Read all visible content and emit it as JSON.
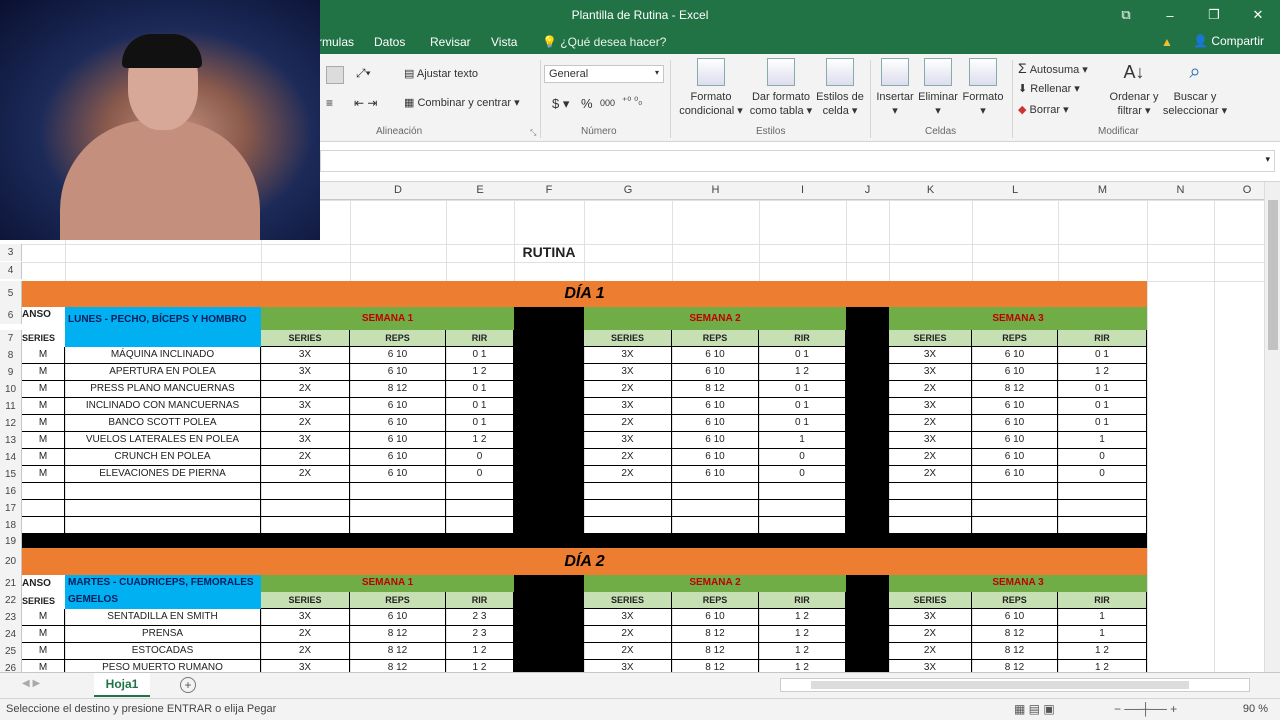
{
  "window": {
    "title": "Plantilla de Rutina - Excel",
    "controls": [
      "⧉",
      "–",
      "❐",
      "✕"
    ]
  },
  "menu": {
    "tabs": [
      "rmulas",
      "Datos",
      "Revisar",
      "Vista"
    ],
    "tell_me": "¿Qué desea hacer?",
    "share": "Compartir"
  },
  "ribbon": {
    "wrap_text": "Ajustar texto",
    "merge_center": "Combinar y centrar",
    "alignment_group": "Alineación",
    "number_format": "General",
    "number_group": "Número",
    "currency_symbol": "$",
    "percent_symbol": "%",
    "thousands_symbol": "000",
    "cond_format_1": "Formato",
    "cond_format_2": "condicional",
    "format_table_1": "Dar formato",
    "format_table_2": "como tabla",
    "cell_styles_1": "Estilos de",
    "cell_styles_2": "celda",
    "styles_group": "Estilos",
    "insert": "Insertar",
    "delete": "Eliminar",
    "format": "Formato",
    "cells_group": "Celdas",
    "autosum": "Autosuma",
    "fill": "Rellenar",
    "clear": "Borrar",
    "sort_1": "Ordenar y",
    "sort_2": "filtrar",
    "find_1": "Buscar y",
    "find_2": "seleccionar",
    "modify_group": "Modificar"
  },
  "columns": [
    "D",
    "E",
    "F",
    "G",
    "H",
    "I",
    "J",
    "K",
    "L",
    "M",
    "N",
    "O"
  ],
  "sheet": {
    "rutina_title": "RUTINA",
    "day1": "DÍA 1",
    "day2": "DÍA 2",
    "day1_name": "LUNES - PECHO, BÍCEPS Y HOMBRO",
    "day2_name": "MARTES - CUADRICEPS, FEMORALES",
    "day2_name_2": "GEMELOS",
    "week1": "SEMANA 1",
    "week2": "SEMANA 2",
    "week3": "SEMANA 3",
    "rest_fragment": "ANSO",
    "rest_series": "SERIES",
    "rest_m": "M",
    "series_hdr": "SERIES",
    "reps_hdr": "REPS",
    "rir_hdr": "RIR",
    "day1_rows": [
      {
        "n": "8",
        "ex": "MÁQUINA INCLINADO",
        "w1": [
          "3X",
          "6 10",
          "0 1"
        ],
        "w2": [
          "3X",
          "6 10",
          "0 1"
        ],
        "w3": [
          "3X",
          "6 10",
          "0 1"
        ]
      },
      {
        "n": "9",
        "ex": "APERTURA EN POLEA",
        "w1": [
          "3X",
          "6 10",
          "1 2"
        ],
        "w2": [
          "3X",
          "6 10",
          "1 2"
        ],
        "w3": [
          "3X",
          "6 10",
          "1 2"
        ]
      },
      {
        "n": "10",
        "ex": "PRESS PLANO MANCUERNAS",
        "w1": [
          "2X",
          "8 12",
          "0 1"
        ],
        "w2": [
          "2X",
          "8 12",
          "0 1"
        ],
        "w3": [
          "2X",
          "8 12",
          "0 1"
        ]
      },
      {
        "n": "11",
        "ex": "INCLINADO CON MANCUERNAS",
        "w1": [
          "3X",
          "6 10",
          "0 1"
        ],
        "w2": [
          "3X",
          "6 10",
          "0 1"
        ],
        "w3": [
          "3X",
          "6 10",
          "0 1"
        ]
      },
      {
        "n": "12",
        "ex": "BANCO SCOTT POLEA",
        "w1": [
          "2X",
          "6 10",
          "0 1"
        ],
        "w2": [
          "2X",
          "6 10",
          "0 1"
        ],
        "w3": [
          "2X",
          "6 10",
          "0 1"
        ]
      },
      {
        "n": "13",
        "ex": "VUELOS LATERALES EN POLEA",
        "w1": [
          "3X",
          "6 10",
          "1 2"
        ],
        "w2": [
          "3X",
          "6 10",
          "1"
        ],
        "w3": [
          "3X",
          "6 10",
          "1"
        ]
      },
      {
        "n": "14",
        "ex": "CRUNCH EN POLEA",
        "w1": [
          "2X",
          "6 10",
          "0"
        ],
        "w2": [
          "2X",
          "6 10",
          "0"
        ],
        "w3": [
          "2X",
          "6 10",
          "0"
        ]
      },
      {
        "n": "15",
        "ex": "ELEVACIONES DE PIERNA",
        "w1": [
          "2X",
          "6 10",
          "0"
        ],
        "w2": [
          "2X",
          "6 10",
          "0"
        ],
        "w3": [
          "2X",
          "6 10",
          "0"
        ]
      }
    ],
    "day2_rows": [
      {
        "n": "23",
        "ex": "SENTADILLA EN SMITH",
        "w1": [
          "3X",
          "6 10",
          "2 3"
        ],
        "w2": [
          "3X",
          "6 10",
          "1 2"
        ],
        "w3": [
          "3X",
          "6 10",
          "1"
        ]
      },
      {
        "n": "24",
        "ex": "PRENSA",
        "w1": [
          "2X",
          "8 12",
          "2 3"
        ],
        "w2": [
          "2X",
          "8 12",
          "1 2"
        ],
        "w3": [
          "2X",
          "8 12",
          "1"
        ]
      },
      {
        "n": "25",
        "ex": "ESTOCADAS",
        "w1": [
          "2X",
          "8 12",
          "1 2"
        ],
        "w2": [
          "2X",
          "8 12",
          "1 2"
        ],
        "w3": [
          "2X",
          "8 12",
          "1 2"
        ]
      },
      {
        "n": "26",
        "ex": "PESO MUERTO RUMANO",
        "w1": [
          "3X",
          "8 12",
          "1 2"
        ],
        "w2": [
          "3X",
          "8 12",
          "1 2"
        ],
        "w3": [
          "3X",
          "8 12",
          "1 2"
        ]
      }
    ]
  },
  "sheet_tab": "Hoja1",
  "add_sheet": "+",
  "status": {
    "message": "Seleccione el destino y presione ENTRAR o elija Pegar",
    "zoom": "90 %"
  },
  "colors": {
    "excel_green": "#217346",
    "orange": "#ed7d31",
    "green": "#70ad47",
    "light_green": "#c6e0b4",
    "blue": "#00b0f0"
  }
}
